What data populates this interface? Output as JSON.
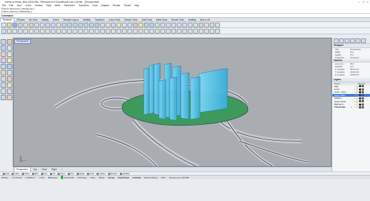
{
  "window": {
    "title": "Home to bench_files (2011/08) - Rhinoceros 6 Educational Lab License - [Perspective]",
    "controls": [
      "–",
      "□",
      "×"
    ]
  },
  "menu": [
    "File",
    "Edit",
    "View",
    "Curve",
    "Surface",
    "Solid",
    "Mesh",
    "Dimension",
    "Transform",
    "Tools",
    "Analyze",
    "Render",
    "Panels",
    "Help"
  ],
  "command_history": [
    "Point to move from ( Vertical=No ):",
    "Point to move to ( Vertical=No ):"
  ],
  "command_prompt": "Command:",
  "toolbar_tabs": [
    {
      "label": "Standard",
      "active": true
    },
    {
      "label": "CPlanes"
    },
    {
      "label": "Set View"
    },
    {
      "label": "Display"
    },
    {
      "label": "Select"
    },
    {
      "label": "Viewport Layout"
    },
    {
      "label": "Visibility"
    },
    {
      "label": "Transform"
    },
    {
      "label": "Curve Tools"
    },
    {
      "label": "Surface Tools"
    },
    {
      "label": "Solid Tools"
    },
    {
      "label": "Mesh Tools"
    },
    {
      "label": "Render Tools"
    },
    {
      "label": "Drafting"
    },
    {
      "label": "New in V6"
    }
  ],
  "viewport": {
    "label": "Perspective",
    "colors": {
      "background": "#a9adb2",
      "ground": "#a5a9ae",
      "paths": "#c3c6ca",
      "green": "#3e9a5c",
      "glass": "#55c4ee"
    }
  },
  "viewport_tabs": [
    {
      "label": "Perspective",
      "active": true
    },
    {
      "label": "Top"
    },
    {
      "label": "Front"
    },
    {
      "label": "Right"
    },
    {
      "label": "+"
    }
  ],
  "osnaps": [
    {
      "label": "End",
      "on": false
    },
    {
      "label": "Near",
      "on": false
    },
    {
      "label": "Point",
      "on": false
    },
    {
      "label": "Mid",
      "on": false
    },
    {
      "label": "Cen",
      "on": false
    },
    {
      "label": "Int",
      "on": false
    },
    {
      "label": "Perp",
      "on": false
    },
    {
      "label": "Tan",
      "on": false
    },
    {
      "label": "Quad",
      "on": false
    },
    {
      "label": "Knot",
      "on": false
    },
    {
      "label": "Vertex",
      "on": false
    },
    {
      "label": "Project",
      "on": false
    },
    {
      "label": "Disable",
      "on": false
    }
  ],
  "status": {
    "cplane": "CPlane",
    "x": "x 17732.22",
    "y": "y 10500.17",
    "z": "z 0.00",
    "units": "Millimeters",
    "layer": "Thresholds",
    "grid_snap": "Grid Snap",
    "ortho": "Ortho",
    "planar": "Planar",
    "osnap": "Osnap",
    "smarttrack": "SmartTrack",
    "gumball": "Gumball",
    "record_history": "Record History",
    "filter": "Filter",
    "memory": "Memory use: 462 MB"
  },
  "properties": {
    "header": "Viewport",
    "rows": [
      {
        "k": "Title",
        "v": "Perspective"
      },
      {
        "k": "Width",
        "v": "674"
      },
      {
        "k": "Height",
        "v": "271"
      },
      {
        "k": "Projection",
        "v": "Perspecti..."
      }
    ],
    "camera_header": "Camera",
    "camera_rows": [
      {
        "k": "Lens Len...",
        "v": "50.0"
      },
      {
        "k": "Rotation",
        "v": "0.0"
      },
      {
        "k": "X Location",
        "v": "58172.32"
      },
      {
        "k": "Y Location",
        "v": "20491.68"
      },
      {
        "k": "Z Location",
        "v": "21604.58"
      }
    ]
  },
  "layers": {
    "header": "Layers",
    "columns": [
      "Name",
      "Material"
    ],
    "items": [
      {
        "name": "Map",
        "color": "#000000",
        "selected": false
      },
      {
        "name": "Lines",
        "color": "#000000",
        "selected": false
      },
      {
        "name": "Lines - Copy",
        "color": "#000000",
        "selected": false
      },
      {
        "name": "Outer Walls",
        "color": "#1a4fff",
        "selected": true
      },
      {
        "name": "Selfskin",
        "color": "#ff0000",
        "selected": false
      },
      {
        "name": "Grace Surfa...",
        "color": "#d6c300",
        "selected": false
      },
      {
        "name": "Bathing S...",
        "color": "#000000",
        "selected": false
      },
      {
        "name": "Thresholds",
        "color": "#1fae3a",
        "selected": false,
        "current": true
      }
    ]
  }
}
